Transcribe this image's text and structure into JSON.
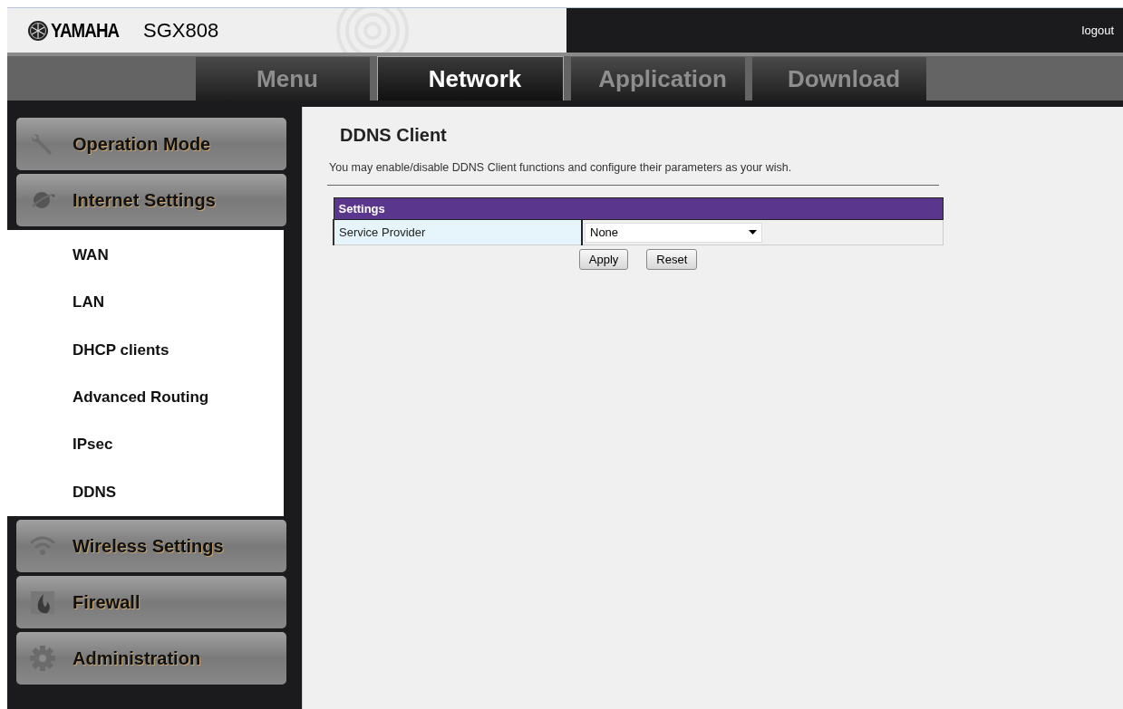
{
  "header": {
    "brand": "YAMAHA",
    "model": "SGX808",
    "logout": "logout"
  },
  "tabs": [
    {
      "label": "Menu",
      "selected": false
    },
    {
      "label": "Network",
      "selected": true
    },
    {
      "label": "Application",
      "selected": false
    },
    {
      "label": "Download",
      "selected": false
    }
  ],
  "sidebar": {
    "items": [
      {
        "label": "Operation Mode"
      },
      {
        "label": "Internet Settings",
        "children": [
          {
            "label": "WAN"
          },
          {
            "label": "LAN"
          },
          {
            "label": "DHCP clients"
          },
          {
            "label": "Advanced Routing"
          },
          {
            "label": "IPsec"
          },
          {
            "label": "DDNS"
          }
        ]
      },
      {
        "label": "Wireless Settings"
      },
      {
        "label": "Firewall"
      },
      {
        "label": "Administration"
      }
    ]
  },
  "content": {
    "title": "DDNS Client",
    "description": "You may enable/disable DDNS Client functions and configure their parameters as your wish.",
    "table": {
      "heading": "Settings",
      "rows": [
        {
          "label": "Service Provider",
          "value": "None"
        }
      ]
    },
    "buttons": [
      "Apply",
      "Reset"
    ]
  }
}
